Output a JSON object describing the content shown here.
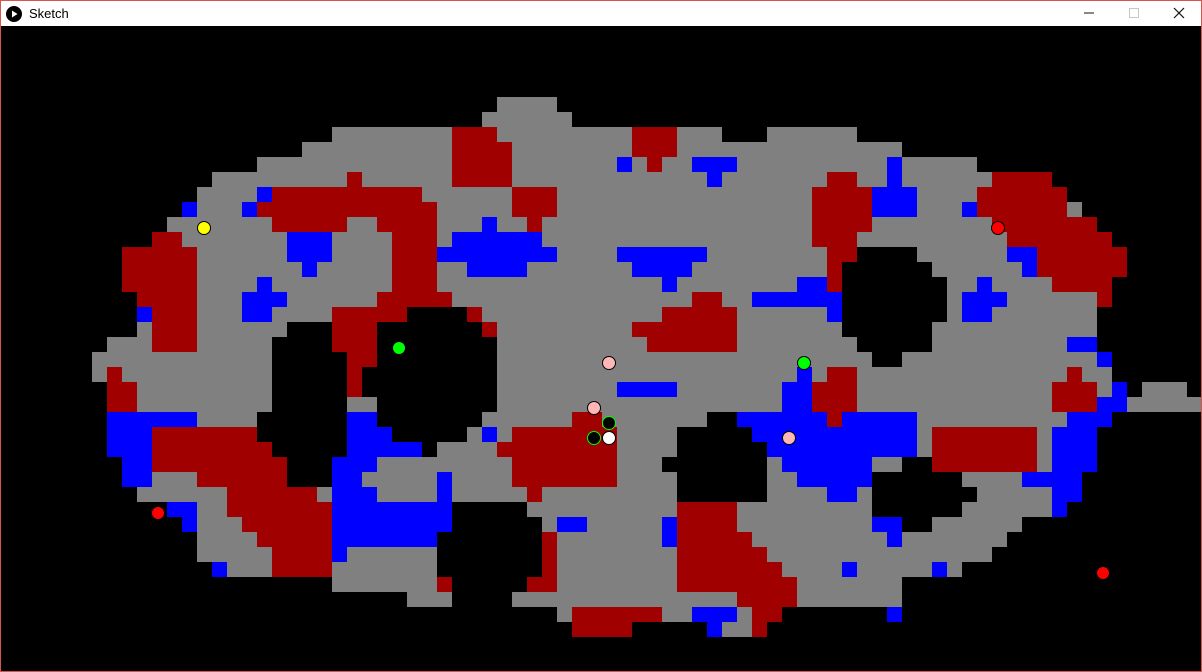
{
  "window": {
    "title": "Sketch",
    "icon": "processing-play-icon",
    "border_color": "#d9534f",
    "controls": [
      "minimize-icon",
      "maximize-icon",
      "close-icon"
    ]
  },
  "game": {
    "background_color": "#000000",
    "terrain_colors": {
      "floor": "#808080",
      "red_team": "#a00000",
      "blue_team": "#0000ff"
    },
    "agents": [
      {
        "color": "#ffff00",
        "label": "yellow-agent"
      },
      {
        "color": "#ff0000",
        "label": "red-agent"
      },
      {
        "color": "#ff0000",
        "label": "red-agent"
      },
      {
        "color": "#ff0000",
        "label": "red-agent"
      },
      {
        "color": "#00ff00",
        "label": "green-agent"
      },
      {
        "color": "#00ff00",
        "label": "green-agent"
      },
      {
        "color": "#ffb6b6",
        "label": "pink-agent"
      },
      {
        "color": "#ffb6b6",
        "label": "pink-agent"
      },
      {
        "color": "#ffb6b6",
        "label": "pink-agent"
      },
      {
        "color": "#000000",
        "label": "black-agent"
      },
      {
        "color": "#000000",
        "label": "black-agent"
      },
      {
        "color": "#ffffff",
        "label": "white-agent"
      }
    ]
  }
}
